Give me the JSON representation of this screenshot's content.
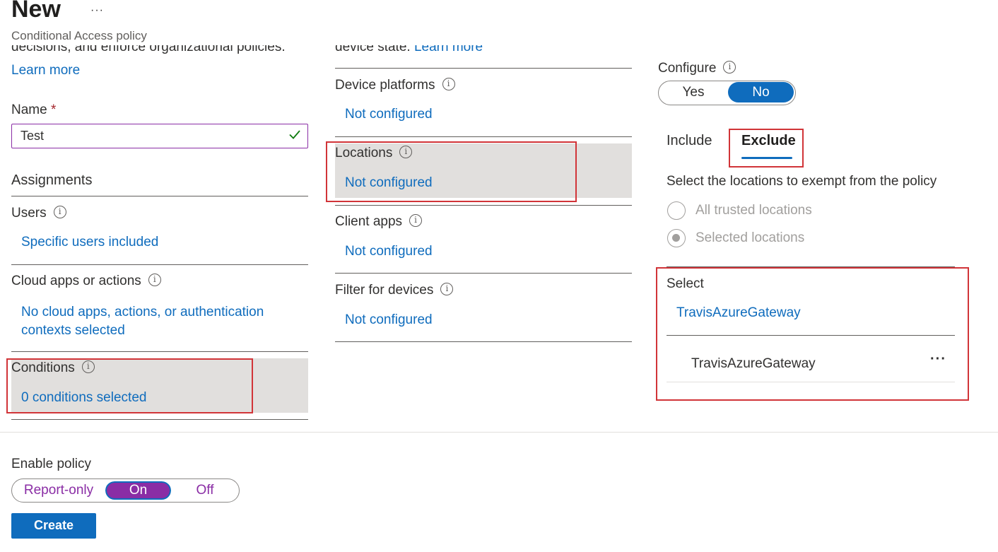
{
  "header": {
    "title": "New",
    "more_label": "···",
    "subtitle": "Conditional Access policy"
  },
  "left": {
    "cut_text": "decisions, and enforce organizational policies.",
    "learn_more": "Learn more",
    "name_label": "Name",
    "required_mark": "*",
    "name_value": "Test",
    "assignments_heading": "Assignments",
    "users_label": "Users",
    "users_value": "Specific users included",
    "cloud_apps_label": "Cloud apps or actions",
    "cloud_apps_value_line1": "No cloud apps, actions, or authentication",
    "cloud_apps_value_line2": "contexts selected",
    "conditions_label": "Conditions",
    "conditions_value": "0 conditions selected"
  },
  "middle": {
    "cut_text": "device state.",
    "cut_link": "Learn more",
    "device_platforms_label": "Device platforms",
    "device_platforms_value": "Not configured",
    "locations_label": "Locations",
    "locations_value": "Not configured",
    "client_apps_label": "Client apps",
    "client_apps_value": "Not configured",
    "filter_devices_label": "Filter for devices",
    "filter_devices_value": "Not configured"
  },
  "right": {
    "configure_label": "Configure",
    "configure_yes": "Yes",
    "configure_no": "No",
    "configure_selected": "No",
    "tab_include": "Include",
    "tab_exclude": "Exclude",
    "active_tab": "Exclude",
    "description": "Select the locations to exempt from the policy",
    "radio_all_trusted": "All trusted locations",
    "radio_selected": "Selected locations",
    "select_label": "Select",
    "select_link": "TravisAzureGateway",
    "selected_item": "TravisAzureGateway",
    "item_more": "···"
  },
  "footer": {
    "enable_policy_label": "Enable policy",
    "opt_report_only": "Report-only",
    "opt_on": "On",
    "opt_off": "Off",
    "selected_option": "On",
    "create_button": "Create"
  },
  "colors": {
    "accent_blue": "#0f6cbd",
    "accent_purple": "#8a2da5",
    "highlight_red": "#d13438",
    "row_gray": "#e1dfdd"
  }
}
